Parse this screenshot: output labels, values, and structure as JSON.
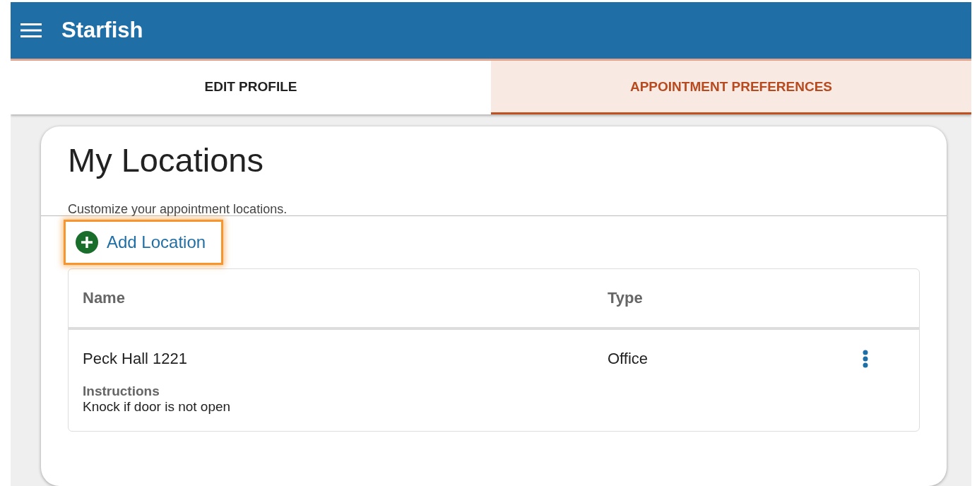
{
  "header": {
    "title": "Starfish"
  },
  "tabs": [
    {
      "label": "EDIT PROFILE",
      "selected": false
    },
    {
      "label": "APPOINTMENT PREFERENCES",
      "selected": true
    }
  ],
  "card": {
    "title": "My Locations",
    "subtitle": "Customize your appointment locations.",
    "add_button": {
      "label": "Add Location",
      "focused": true
    }
  },
  "table": {
    "columns": [
      "Name",
      "Type"
    ],
    "rows": [
      {
        "name": "Peck Hall 1221",
        "type": "Office",
        "instructions_label": "Instructions",
        "instructions": "Knock if door is not open"
      }
    ]
  }
}
